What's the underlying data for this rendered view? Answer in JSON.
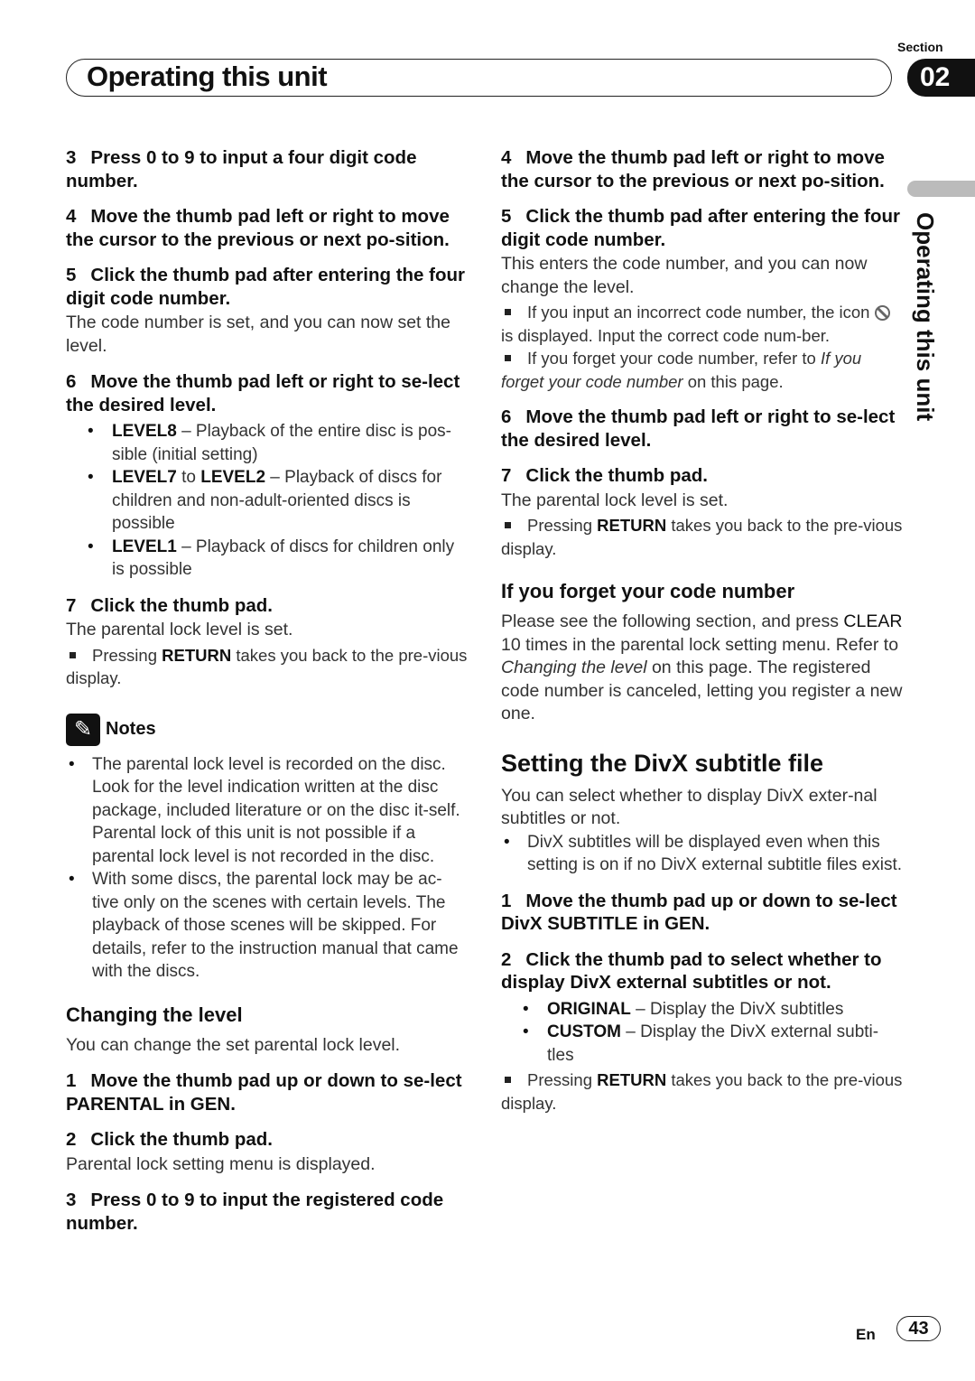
{
  "header": {
    "title": "Operating this unit",
    "section_label": "Section",
    "section_number": "02",
    "side_tab_text": "Operating this unit"
  },
  "left": {
    "s3": {
      "n": "3",
      "t": "Press 0 to 9 to input a four digit code number."
    },
    "s4": {
      "n": "4",
      "t": "Move the thumb pad left or right to move the cursor to the previous or next po-sition."
    },
    "s5": {
      "n": "5",
      "t": "Click the thumb pad after entering the four digit code number."
    },
    "s5p": "The code number is set, and you can now set the level.",
    "s6": {
      "n": "6",
      "t": "Move the thumb pad left or right to se-lect the desired level."
    },
    "levels": [
      {
        "b": "LEVEL8",
        "t": " – Playback of the entire disc is pos-sible (initial setting)"
      },
      {
        "b": "LEVEL7",
        "mid": " to ",
        "b2": "LEVEL2",
        "t": " – Playback of discs for children and non-adult-oriented discs is possible"
      },
      {
        "b": "LEVEL1",
        "t": " – Playback of discs for children only is possible"
      }
    ],
    "s7": {
      "n": "7",
      "t": "Click the thumb pad."
    },
    "s7p": "The parental lock level is set.",
    "s7note": {
      "pre": "Pressing ",
      "b": "RETURN",
      "post": " takes you back to the pre-vious display."
    },
    "notes_label": "Notes",
    "notes": [
      "The parental lock level is recorded on the disc. Look for the level indication written at the disc package, included literature or on the disc it-self. Parental lock of this unit is not possible if a parental lock level is not recorded in the disc.",
      "With some discs, the parental lock may be ac-tive only on the scenes with certain levels. The playback of those scenes will be skipped. For details, refer to the instruction manual that came with the discs."
    ],
    "changing_heading": "Changing the level",
    "changing_p": "You can change the set parental lock level.",
    "c1": {
      "n": "1",
      "t": "Move the thumb pad up or down to se-lect PARENTAL in GEN."
    },
    "c2": {
      "n": "2",
      "t": "Click the thumb pad."
    },
    "c2p": "Parental lock setting menu is displayed.",
    "c3": {
      "n": "3",
      "t": "Press 0 to 9 to input the registered code number."
    }
  },
  "right": {
    "s4": {
      "n": "4",
      "t": "Move the thumb pad left or right to move the cursor to the previous or next po-sition."
    },
    "s5": {
      "n": "5",
      "t": "Click the thumb pad after entering the four digit code number."
    },
    "s5p": "This enters the code number, and you can now change the level.",
    "n1a": "If you input an incorrect code number, the icon ",
    "n1b": " is displayed. Input the correct code num-ber.",
    "n2a": "If you forget your code number, refer to ",
    "n2i": "If you forget your code number",
    "n2b": " on this page.",
    "s6": {
      "n": "6",
      "t": "Move the thumb pad left or right to se-lect the desired level."
    },
    "s7": {
      "n": "7",
      "t": "Click the thumb pad."
    },
    "s7p": "The parental lock level is set.",
    "s7note": {
      "pre": "Pressing ",
      "b": "RETURN",
      "post": " takes you back to the pre-vious display."
    },
    "forget_heading": "If you forget your code number",
    "forget_a": "Please see the following section, and press ",
    "forget_b": "CLEAR",
    "forget_c": " 10 times in the parental lock setting menu. Refer to ",
    "forget_i": "Changing the level",
    "forget_d": " on this page. The registered code number is canceled, letting you register a new one.",
    "divx_heading": "Setting the DivX subtitle file",
    "divx_p": "You can select whether to display DivX exter-nal subtitles or not.",
    "divx_bullet": "DivX subtitles will be displayed even when this setting is on if no DivX external subtitle files exist.",
    "d1": {
      "n": "1",
      "t": "Move the thumb pad up or down to se-lect DivX SUBTITLE in GEN."
    },
    "d2": {
      "n": "2",
      "t": "Click the thumb pad to select whether to display DivX external subtitles or not."
    },
    "options": [
      {
        "b": "ORIGINAL",
        "t": " – Display the DivX subtitles"
      },
      {
        "b": "CUSTOM",
        "t": " – Display the DivX external subti-tles"
      }
    ],
    "d2note": {
      "pre": "Pressing ",
      "b": "RETURN",
      "post": " takes you back to the pre-vious display."
    }
  },
  "footer": {
    "lang": "En",
    "page": "43"
  }
}
